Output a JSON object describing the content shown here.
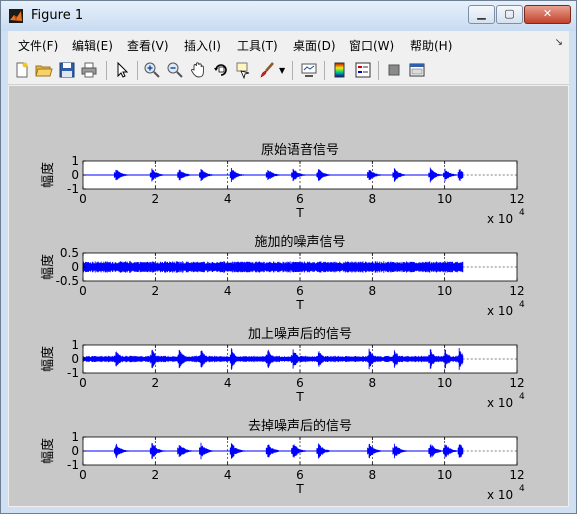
{
  "window": {
    "title": "Figure 1",
    "minimize": "▁",
    "maximize": "▢",
    "close": "✕"
  },
  "menu": [
    "文件(F)",
    "编辑(E)",
    "查看(V)",
    "插入(I)",
    "工具(T)",
    "桌面(D)",
    "窗口(W)",
    "帮助(H)"
  ],
  "toolbar_icons": [
    "new-figure-icon",
    "open-file-icon",
    "save-icon",
    "print-icon",
    "pointer-icon",
    "zoom-in-icon",
    "zoom-out-icon",
    "pan-icon",
    "rotate-3d-icon",
    "data-cursor-icon",
    "brush-icon",
    "brush-dropdown-icon",
    "link-plot-icon",
    "colorbar-icon",
    "legend-icon",
    "hide-plot-tools-icon",
    "show-plot-tools-icon"
  ],
  "plots": [
    {
      "title": "原始语音信号",
      "ylabel": "幅度",
      "xlabel": "T",
      "yticks": [
        "1",
        "0",
        "-1"
      ],
      "ylim": [
        -1,
        1
      ],
      "envelope": "speech",
      "amp": 0.25
    },
    {
      "title": "施加的噪声信号",
      "ylabel": "幅度",
      "xlabel": "T",
      "yticks": [
        "0.5",
        "0",
        "-0.5"
      ],
      "ylim": [
        -0.5,
        0.5
      ],
      "envelope": "noise",
      "amp": 0.42
    },
    {
      "title": "加上噪声后的信号",
      "ylabel": "幅度",
      "xlabel": "T",
      "yticks": [
        "1",
        "0",
        "-1"
      ],
      "ylim": [
        -1,
        1
      ],
      "envelope": "noisy",
      "amp": 0.4
    },
    {
      "title": "去掉噪声后的信号",
      "ylabel": "幅度",
      "xlabel": "T",
      "yticks": [
        "1",
        "0",
        "-1"
      ],
      "ylim": [
        -1,
        1
      ],
      "envelope": "speech",
      "amp": 0.3
    }
  ],
  "xticks": [
    "0",
    "2",
    "4",
    "6",
    "8",
    "10",
    "12"
  ],
  "xscale": "x 10",
  "xscale_exp": "4",
  "chart_data": [
    {
      "type": "line",
      "title": "原始语音信号",
      "xlabel": "T",
      "ylabel": "幅度",
      "xlim": [
        0,
        120000
      ],
      "ylim": [
        -1,
        1
      ],
      "x_multiplier": "x 10^4",
      "signal_end": 105000,
      "series": [
        {
          "color": "#0000ff"
        }
      ]
    },
    {
      "type": "line",
      "title": "施加的噪声信号",
      "xlabel": "T",
      "ylabel": "幅度",
      "xlim": [
        0,
        120000
      ],
      "ylim": [
        -0.5,
        0.5
      ],
      "x_multiplier": "x 10^4",
      "signal_end": 105000,
      "series": [
        {
          "color": "#0000ff"
        }
      ]
    },
    {
      "type": "line",
      "title": "加上噪声后的信号",
      "xlabel": "T",
      "ylabel": "幅度",
      "xlim": [
        0,
        120000
      ],
      "ylim": [
        -1,
        1
      ],
      "x_multiplier": "x 10^4",
      "signal_end": 105000,
      "series": [
        {
          "color": "#0000ff"
        }
      ]
    },
    {
      "type": "line",
      "title": "去掉噪声后的信号",
      "xlabel": "T",
      "ylabel": "幅度",
      "xlim": [
        0,
        120000
      ],
      "ylim": [
        -1,
        1
      ],
      "x_multiplier": "x 10^4",
      "signal_end": 105000,
      "series": [
        {
          "color": "#0000ff"
        }
      ]
    }
  ]
}
